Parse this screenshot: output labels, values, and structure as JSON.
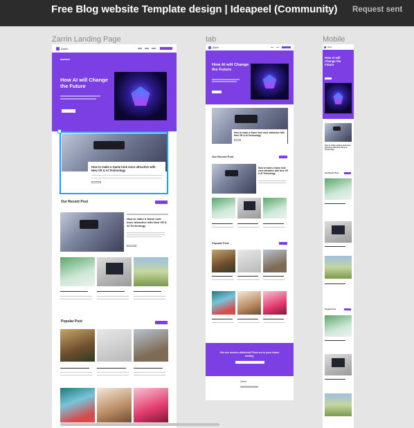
{
  "window": {
    "title": "Free Blog website Template design | Ideapeel (Community)",
    "title_menu_icon": "chevron-down-icon",
    "request_button": "Request sent"
  },
  "frames": {
    "desktop_label": "Zarrin Landing Page",
    "tablet_label": "tab",
    "mobile_label": "Mobile"
  },
  "design": {
    "brand": "Zarrin",
    "hero_title": "How AI will Change the Future",
    "featured_title": "How to make a Game look more attractive with New VR & AI Technology",
    "recent_section": "Our Recent Post",
    "popular_section": "Popular Post",
    "newsletter_title": "Get our stories delivered From us to your inbox weekly.",
    "accent": "#7b3fe4",
    "selection": "#18a0fb"
  }
}
